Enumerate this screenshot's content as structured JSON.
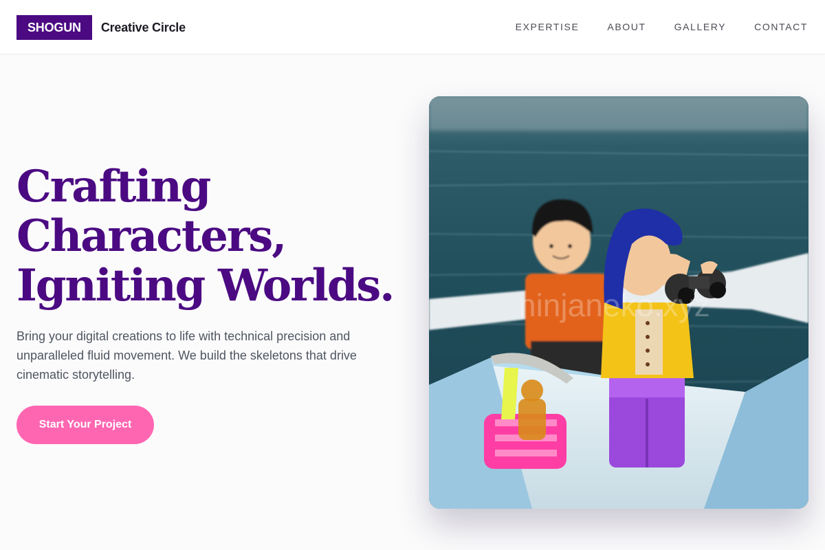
{
  "brand": {
    "logo": "SHOGUN",
    "name": "Creative Circle"
  },
  "nav": {
    "items": [
      "EXPERTISE",
      "ABOUT",
      "GALLERY",
      "CONTACT"
    ]
  },
  "hero": {
    "title_lines": [
      "Crafting",
      "Characters,",
      "Igniting Worlds."
    ],
    "description": "Bring your digital creations to life with technical precision and unparalleled fluid movement. We build the skeletons that drive cinematic storytelling.",
    "cta_label": "Start Your Project",
    "image_watermark": "ninjaneko.xyz"
  },
  "colors": {
    "brand_purple": "#4b0a82",
    "cta_pink": "#ff66b2",
    "body_text": "#4f5560"
  }
}
